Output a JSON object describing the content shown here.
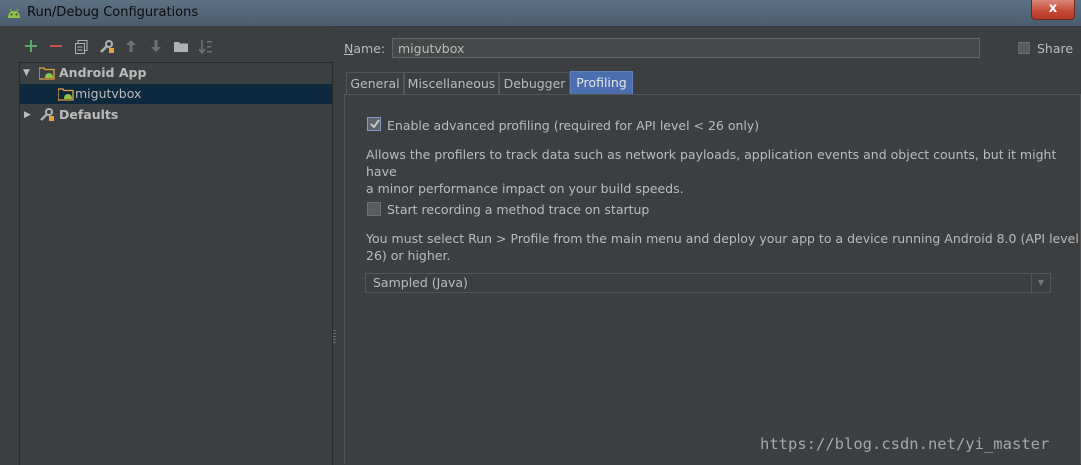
{
  "window": {
    "title": "Run/Debug Configurations",
    "close_glyph": "x"
  },
  "toolbar": {
    "icons": [
      "add-icon",
      "remove-icon",
      "copy-icon",
      "edit-defaults-icon",
      "move-up-icon",
      "move-down-icon",
      "folder-icon",
      "sort-icon"
    ]
  },
  "tree": {
    "items": [
      {
        "label": "Android App",
        "icon": "android-folder-icon",
        "expanded": true
      },
      {
        "label": "migutvbox",
        "icon": "android-config-icon",
        "selected": true
      },
      {
        "label": "Defaults",
        "icon": "wrench-icon",
        "expanded": false
      }
    ]
  },
  "form": {
    "name_label": "ame:",
    "name_mnemonic": "N",
    "name_value": "migutvbox",
    "share_label": "Share"
  },
  "tabs": [
    {
      "label": "General"
    },
    {
      "label": "Miscellaneous"
    },
    {
      "label": "Debugger"
    },
    {
      "label": "Profiling",
      "active": true
    }
  ],
  "profiling": {
    "advanced_label": "Enable advanced profiling (required for API level < 26 only)",
    "advanced_checked": true,
    "advanced_desc_line1": "Allows the profilers to track data such as network payloads, application events and object counts, but it might have",
    "advanced_desc_line2": "a minor performance impact on your build speeds.",
    "trace_label": "Start recording a method trace on startup",
    "trace_checked": false,
    "trace_desc_line1": "You must select Run > Profile from the main menu and deploy your app to a device running Android 8.0 (API level",
    "trace_desc_line2": "26) or higher.",
    "trace_mode": "Sampled (Java)"
  },
  "watermark": "https://blog.csdn.net/yi_master",
  "colors": {
    "accent_tab": "#4b6eaf",
    "selection": "#0d293e",
    "add_green": "#59a869",
    "remove_red": "#c75450"
  }
}
